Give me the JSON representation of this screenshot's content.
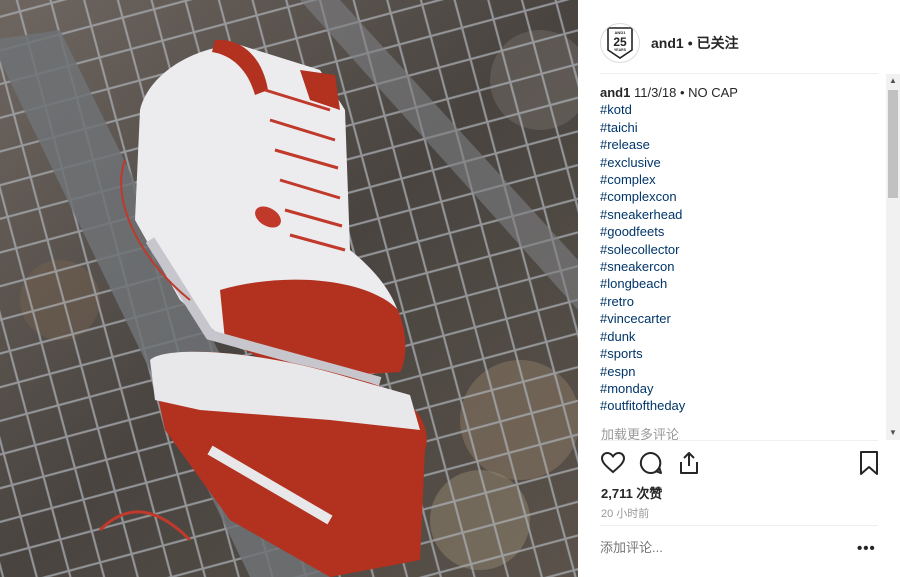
{
  "post": {
    "account": "and1",
    "separator": "•",
    "follow_status": "已关注",
    "avatar_badge_top": "AND1",
    "avatar_badge_number": "25",
    "avatar_badge_bottom": "YEARS",
    "caption_user": "and1",
    "caption_text": " 11/3/18 • NO CAP",
    "hashtags": [
      "#kotd",
      "#taichi",
      "#release",
      "#exclusive",
      "#complex",
      "#complexcon",
      "#sneakerhead",
      "#goodfeets",
      "#solecollector",
      "#sneakercon",
      "#longbeach",
      "#retro",
      "#vincecarter",
      "#dunk",
      "#sports",
      "#espn",
      "#monday",
      "#outfitoftheday"
    ],
    "load_more": "加载更多评论",
    "likes": "2,711 次赞",
    "time_ago": "20 小时前",
    "comment_placeholder": "添加评论...",
    "more_options": "•••"
  },
  "icons": [
    "heart-icon",
    "comment-icon",
    "share-icon",
    "bookmark-icon"
  ],
  "colors": {
    "hashtag": "#003569",
    "muted": "#999999",
    "shoe_red": "#c0392b"
  }
}
